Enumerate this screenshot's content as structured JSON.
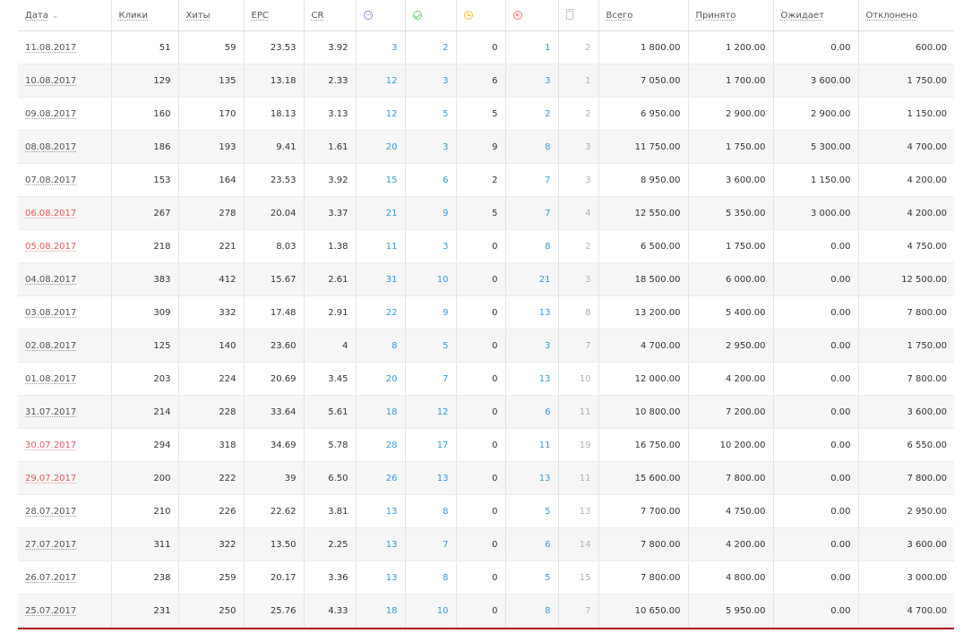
{
  "header": {
    "date": "Дата",
    "sort_glyph": "⌄",
    "clicks": "Клики",
    "hits": "Хиты",
    "epc": "EPC",
    "cr": "CR",
    "icons": [
      "dots-circle-icon",
      "check-circle-icon",
      "clock-circle-icon",
      "x-circle-icon",
      "trash-icon"
    ],
    "total": "Всего",
    "accepted": "Принято",
    "pending": "Ожидает",
    "rejected": "Отклонено"
  },
  "colors": {
    "link_blue": "#3a9ad9",
    "weekend_red": "#e05a5a",
    "bottom_bar": "#b01c1c"
  },
  "rows": [
    {
      "date": "11.08.2017",
      "weekend": false,
      "clicks": "51",
      "hits": "59",
      "epc": "23.53",
      "cr": "3.92",
      "c1": "3",
      "c2": "2",
      "c3": "0",
      "c4": "1",
      "c5": "2",
      "total": "1 800.00",
      "accepted": "1 200.00",
      "pending": "0.00",
      "rejected": "600.00"
    },
    {
      "date": "10.08.2017",
      "weekend": false,
      "clicks": "129",
      "hits": "135",
      "epc": "13.18",
      "cr": "2.33",
      "c1": "12",
      "c2": "3",
      "c3": "6",
      "c4": "3",
      "c5": "1",
      "total": "7 050.00",
      "accepted": "1 700.00",
      "pending": "3 600.00",
      "rejected": "1 750.00"
    },
    {
      "date": "09.08.2017",
      "weekend": false,
      "clicks": "160",
      "hits": "170",
      "epc": "18.13",
      "cr": "3.13",
      "c1": "12",
      "c2": "5",
      "c3": "5",
      "c4": "2",
      "c5": "2",
      "total": "6 950.00",
      "accepted": "2 900.00",
      "pending": "2 900.00",
      "rejected": "1 150.00"
    },
    {
      "date": "08.08.2017",
      "weekend": false,
      "clicks": "186",
      "hits": "193",
      "epc": "9.41",
      "cr": "1.61",
      "c1": "20",
      "c2": "3",
      "c3": "9",
      "c4": "8",
      "c5": "3",
      "total": "11 750.00",
      "accepted": "1 750.00",
      "pending": "5 300.00",
      "rejected": "4 700.00"
    },
    {
      "date": "07.08.2017",
      "weekend": false,
      "clicks": "153",
      "hits": "164",
      "epc": "23.53",
      "cr": "3.92",
      "c1": "15",
      "c2": "6",
      "c3": "2",
      "c4": "7",
      "c5": "3",
      "total": "8 950.00",
      "accepted": "3 600.00",
      "pending": "1 150.00",
      "rejected": "4 200.00"
    },
    {
      "date": "06.08.2017",
      "weekend": true,
      "clicks": "267",
      "hits": "278",
      "epc": "20.04",
      "cr": "3.37",
      "c1": "21",
      "c2": "9",
      "c3": "5",
      "c4": "7",
      "c5": "4",
      "total": "12 550.00",
      "accepted": "5 350.00",
      "pending": "3 000.00",
      "rejected": "4 200.00"
    },
    {
      "date": "05.08.2017",
      "weekend": true,
      "clicks": "218",
      "hits": "221",
      "epc": "8.03",
      "cr": "1.38",
      "c1": "11",
      "c2": "3",
      "c3": "0",
      "c4": "8",
      "c5": "2",
      "total": "6 500.00",
      "accepted": "1 750.00",
      "pending": "0.00",
      "rejected": "4 750.00"
    },
    {
      "date": "04.08.2017",
      "weekend": false,
      "clicks": "383",
      "hits": "412",
      "epc": "15.67",
      "cr": "2.61",
      "c1": "31",
      "c2": "10",
      "c3": "0",
      "c4": "21",
      "c5": "3",
      "total": "18 500.00",
      "accepted": "6 000.00",
      "pending": "0.00",
      "rejected": "12 500.00"
    },
    {
      "date": "03.08.2017",
      "weekend": false,
      "clicks": "309",
      "hits": "332",
      "epc": "17.48",
      "cr": "2.91",
      "c1": "22",
      "c2": "9",
      "c3": "0",
      "c4": "13",
      "c5": "8",
      "total": "13 200.00",
      "accepted": "5 400.00",
      "pending": "0.00",
      "rejected": "7 800.00"
    },
    {
      "date": "02.08.2017",
      "weekend": false,
      "clicks": "125",
      "hits": "140",
      "epc": "23.60",
      "cr": "4",
      "c1": "8",
      "c2": "5",
      "c3": "0",
      "c4": "3",
      "c5": "7",
      "total": "4 700.00",
      "accepted": "2 950.00",
      "pending": "0.00",
      "rejected": "1 750.00"
    },
    {
      "date": "01.08.2017",
      "weekend": false,
      "clicks": "203",
      "hits": "224",
      "epc": "20.69",
      "cr": "3.45",
      "c1": "20",
      "c2": "7",
      "c3": "0",
      "c4": "13",
      "c5": "10",
      "total": "12 000.00",
      "accepted": "4 200.00",
      "pending": "0.00",
      "rejected": "7 800.00"
    },
    {
      "date": "31.07.2017",
      "weekend": false,
      "clicks": "214",
      "hits": "228",
      "epc": "33.64",
      "cr": "5.61",
      "c1": "18",
      "c2": "12",
      "c3": "0",
      "c4": "6",
      "c5": "11",
      "total": "10 800.00",
      "accepted": "7 200.00",
      "pending": "0.00",
      "rejected": "3 600.00"
    },
    {
      "date": "30.07.2017",
      "weekend": true,
      "clicks": "294",
      "hits": "318",
      "epc": "34.69",
      "cr": "5.78",
      "c1": "28",
      "c2": "17",
      "c3": "0",
      "c4": "11",
      "c5": "19",
      "total": "16 750.00",
      "accepted": "10 200.00",
      "pending": "0.00",
      "rejected": "6 550.00"
    },
    {
      "date": "29.07.2017",
      "weekend": true,
      "clicks": "200",
      "hits": "222",
      "epc": "39",
      "cr": "6.50",
      "c1": "26",
      "c2": "13",
      "c3": "0",
      "c4": "13",
      "c5": "11",
      "total": "15 600.00",
      "accepted": "7 800.00",
      "pending": "0.00",
      "rejected": "7 800.00"
    },
    {
      "date": "28.07.2017",
      "weekend": false,
      "clicks": "210",
      "hits": "226",
      "epc": "22.62",
      "cr": "3.81",
      "c1": "13",
      "c2": "8",
      "c3": "0",
      "c4": "5",
      "c5": "13",
      "total": "7 700.00",
      "accepted": "4 750.00",
      "pending": "0.00",
      "rejected": "2 950.00"
    },
    {
      "date": "27.07.2017",
      "weekend": false,
      "clicks": "311",
      "hits": "322",
      "epc": "13.50",
      "cr": "2.25",
      "c1": "13",
      "c2": "7",
      "c3": "0",
      "c4": "6",
      "c5": "14",
      "total": "7 800.00",
      "accepted": "4 200.00",
      "pending": "0.00",
      "rejected": "3 600.00"
    },
    {
      "date": "26.07.2017",
      "weekend": false,
      "clicks": "238",
      "hits": "259",
      "epc": "20.17",
      "cr": "3.36",
      "c1": "13",
      "c2": "8",
      "c3": "0",
      "c4": "5",
      "c5": "15",
      "total": "7 800.00",
      "accepted": "4 800.00",
      "pending": "0.00",
      "rejected": "3 000.00"
    },
    {
      "date": "25.07.2017",
      "weekend": false,
      "clicks": "231",
      "hits": "250",
      "epc": "25.76",
      "cr": "4.33",
      "c1": "18",
      "c2": "10",
      "c3": "0",
      "c4": "8",
      "c5": "7",
      "total": "10 650.00",
      "accepted": "5 950.00",
      "pending": "0.00",
      "rejected": "4 700.00"
    }
  ]
}
